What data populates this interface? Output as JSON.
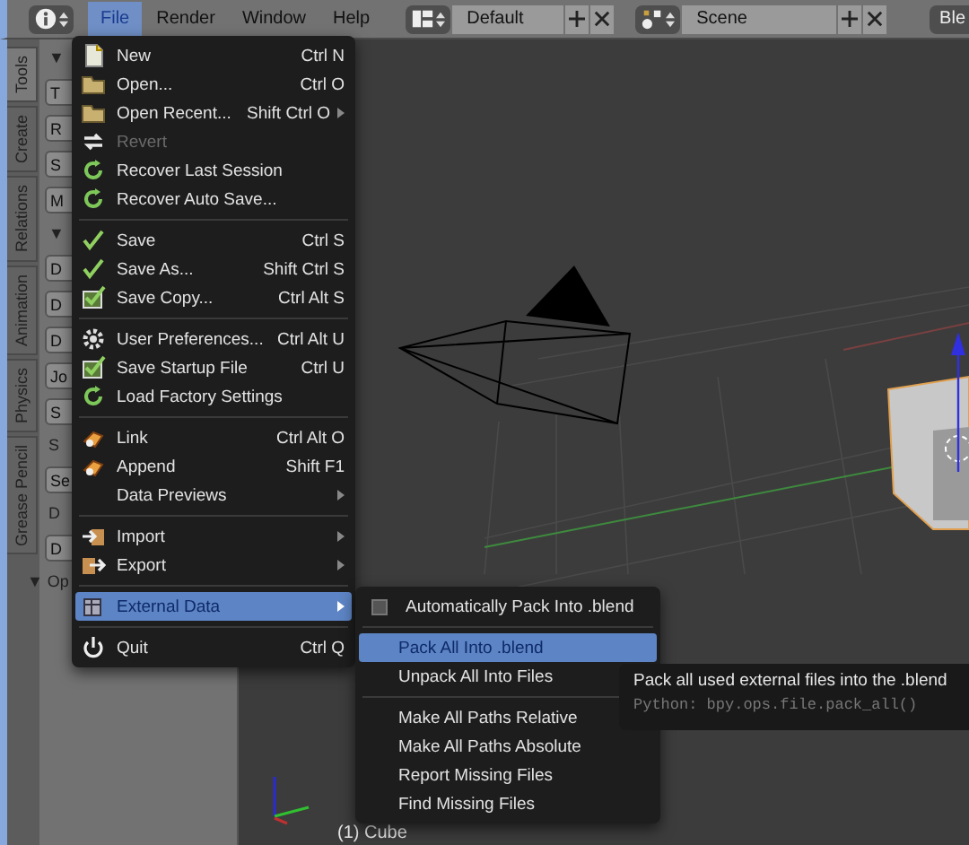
{
  "header": {
    "menus": [
      {
        "label": "File",
        "selected": true
      },
      {
        "label": "Render",
        "selected": false
      },
      {
        "label": "Window",
        "selected": false
      },
      {
        "label": "Help",
        "selected": false
      }
    ],
    "layout": {
      "value": "Default"
    },
    "scene": {
      "value": "Scene"
    },
    "editor_cut": "Ble"
  },
  "tool_shelf": {
    "tabs": [
      {
        "label": "Tools",
        "selected": true
      },
      {
        "label": "Create",
        "selected": false
      },
      {
        "label": "Relations",
        "selected": false
      },
      {
        "label": "Animation",
        "selected": false
      },
      {
        "label": "Physics",
        "selected": false
      },
      {
        "label": "Grease Pencil",
        "selected": false
      }
    ],
    "fragments": [
      {
        "kind": "heading",
        "label": "▼"
      },
      {
        "kind": "button",
        "label": "T"
      },
      {
        "kind": "button",
        "label": "R"
      },
      {
        "kind": "button",
        "label": "S"
      },
      {
        "kind": "button",
        "label": "M"
      },
      {
        "kind": "heading",
        "label": "▼"
      },
      {
        "kind": "button",
        "label": "D"
      },
      {
        "kind": "button",
        "label": "D"
      },
      {
        "kind": "button",
        "label": "D"
      },
      {
        "kind": "button",
        "label": "Jo"
      },
      {
        "kind": "button",
        "label": "S"
      },
      {
        "kind": "text",
        "label": "S"
      },
      {
        "kind": "button",
        "label": "Se"
      },
      {
        "kind": "text",
        "label": "D"
      },
      {
        "kind": "button",
        "label": "D"
      },
      {
        "kind": "heading",
        "label": "▼ Op"
      }
    ]
  },
  "viewport": {
    "object_label": "(1) Cube"
  },
  "file_menu": {
    "sections": [
      [
        {
          "label": "New",
          "shortcut": "Ctrl N",
          "submenu": false,
          "disabled": false,
          "selected": false
        },
        {
          "label": "Open...",
          "shortcut": "Ctrl O",
          "submenu": false,
          "disabled": false,
          "selected": false
        },
        {
          "label": "Open Recent...",
          "shortcut": "Shift Ctrl O",
          "submenu": true,
          "disabled": false,
          "selected": false
        },
        {
          "label": "Revert",
          "submenu": false,
          "disabled": true,
          "selected": false
        },
        {
          "label": "Recover Last Session",
          "submenu": false,
          "disabled": false,
          "selected": false
        },
        {
          "label": "Recover Auto Save...",
          "submenu": false,
          "disabled": false,
          "selected": false
        }
      ],
      [
        {
          "label": "Save",
          "shortcut": "Ctrl S",
          "submenu": false,
          "disabled": false,
          "selected": false
        },
        {
          "label": "Save As...",
          "shortcut": "Shift Ctrl S",
          "submenu": false,
          "disabled": false,
          "selected": false
        },
        {
          "label": "Save Copy...",
          "shortcut": "Ctrl Alt S",
          "submenu": false,
          "disabled": false,
          "selected": false
        }
      ],
      [
        {
          "label": "User Preferences...",
          "shortcut": "Ctrl Alt U",
          "submenu": false,
          "disabled": false,
          "selected": false
        },
        {
          "label": "Save Startup File",
          "shortcut": "Ctrl U",
          "submenu": false,
          "disabled": false,
          "selected": false
        },
        {
          "label": "Load Factory Settings",
          "submenu": false,
          "disabled": false,
          "selected": false
        }
      ],
      [
        {
          "label": "Link",
          "shortcut": "Ctrl Alt O",
          "submenu": false,
          "disabled": false,
          "selected": false
        },
        {
          "label": "Append",
          "shortcut": "Shift F1",
          "submenu": false,
          "disabled": false,
          "selected": false
        },
        {
          "label": "Data Previews",
          "submenu": true,
          "disabled": false,
          "selected": false
        }
      ],
      [
        {
          "label": "Import",
          "submenu": true,
          "disabled": false,
          "selected": false
        },
        {
          "label": "Export",
          "submenu": true,
          "disabled": false,
          "selected": false
        }
      ],
      [
        {
          "label": "External Data",
          "submenu": true,
          "disabled": false,
          "selected": true
        }
      ],
      [
        {
          "label": "Quit",
          "shortcut": "Ctrl Q",
          "submenu": false,
          "disabled": false,
          "selected": false
        }
      ]
    ]
  },
  "external_data_menu": {
    "sections": [
      [
        {
          "kind": "checkbox",
          "label": "Automatically Pack Into .blend",
          "checked": false
        }
      ],
      [
        {
          "kind": "item",
          "label": "Pack All Into .blend",
          "selected": true
        },
        {
          "kind": "item",
          "label": "Unpack All Into Files",
          "selected": false
        }
      ],
      [
        {
          "kind": "item",
          "label": "Make All Paths Relative",
          "selected": false
        },
        {
          "kind": "item",
          "label": "Make All Paths Absolute",
          "selected": false
        },
        {
          "kind": "item",
          "label": "Report Missing Files",
          "selected": false
        },
        {
          "kind": "item",
          "label": "Find Missing Files",
          "selected": false
        }
      ]
    ]
  },
  "tooltip": {
    "text": "Pack all used external files into the .blend",
    "python": "Python: bpy.ops.file.pack_all()"
  }
}
